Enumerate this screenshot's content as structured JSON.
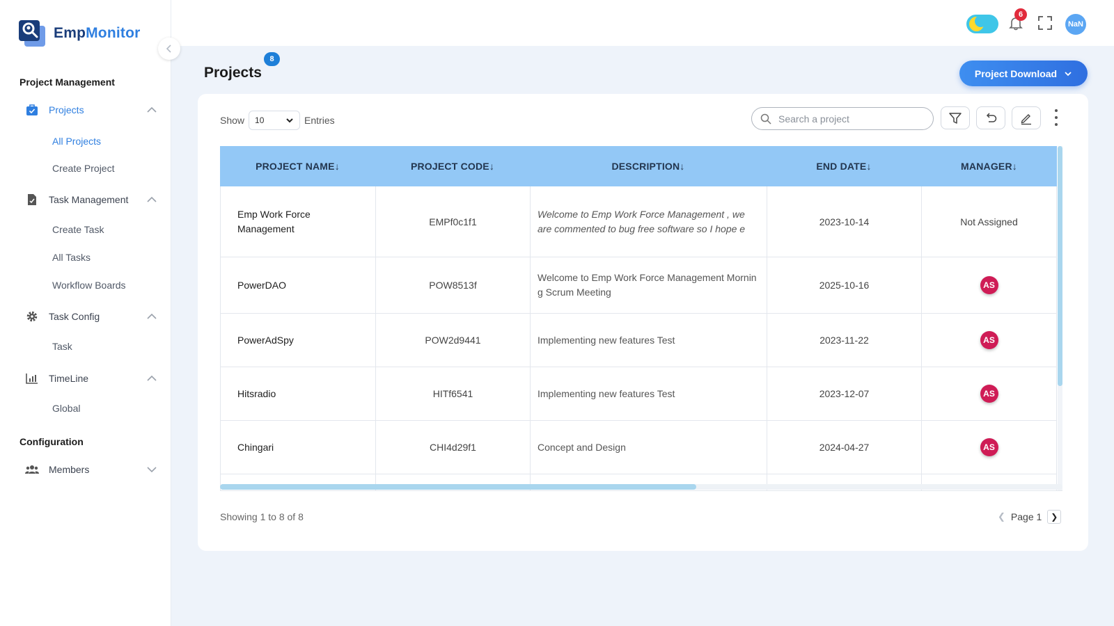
{
  "brand": {
    "name_part1": "Emp",
    "name_part2": "Monitor"
  },
  "sidebar": {
    "section1": "Project Management",
    "section2": "Configuration",
    "projects": {
      "label": "Projects",
      "children": [
        "All Projects",
        "Create Project"
      ]
    },
    "task_management": {
      "label": "Task Management",
      "children": [
        "Create Task",
        "All Tasks",
        "Workflow Boards"
      ]
    },
    "task_config": {
      "label": "Task Config",
      "children": [
        "Task"
      ]
    },
    "timeline": {
      "label": "TimeLine",
      "children": [
        "Global"
      ]
    },
    "members": {
      "label": "Members"
    }
  },
  "topbar": {
    "notifications_count": "6",
    "avatar_text": "NaN"
  },
  "page": {
    "title": "Projects",
    "count": "8",
    "download_label": "Project Download"
  },
  "controls": {
    "show_label": "Show",
    "entries_value": "10",
    "entries_label": "Entries",
    "search_placeholder": "Search a project"
  },
  "table": {
    "headers": [
      "PROJECT NAME",
      "PROJECT CODE",
      "DESCRIPTION",
      "END DATE",
      "MANAGER"
    ],
    "rows": [
      {
        "name": "Emp Work Force Management",
        "code": "EMPf0c1f1",
        "description": "Welcome to Emp Work Force Management , we are commented to bug free software so I hope e",
        "end_date": "2023-10-14",
        "manager": "Not Assigned"
      },
      {
        "name": "PowerDAO",
        "code": "POW8513f",
        "description": "Welcome to Emp Work Force Management Morning Scrum Meeting",
        "end_date": "2025-10-16",
        "manager": "AS"
      },
      {
        "name": "PowerAdSpy",
        "code": "POW2d9441",
        "description": "Implementing new features Test",
        "end_date": "2023-11-22",
        "manager": "AS"
      },
      {
        "name": "Hitsradio",
        "code": "HITf6541",
        "description": "Implementing new features Test",
        "end_date": "2023-12-07",
        "manager": "AS"
      },
      {
        "name": "Chingari",
        "code": "CHI4d29f1",
        "description": "Concept and Design",
        "end_date": "2024-04-27",
        "manager": "AS"
      }
    ]
  },
  "footer": {
    "showing": "Showing 1 to 8 of 8",
    "page_label": "Page 1"
  },
  "colors": {
    "accent": "#2f7fe0",
    "header_bg": "#93c8f6",
    "manager_avatar": "#cf1c56",
    "badge_red": "#e12b3c"
  }
}
